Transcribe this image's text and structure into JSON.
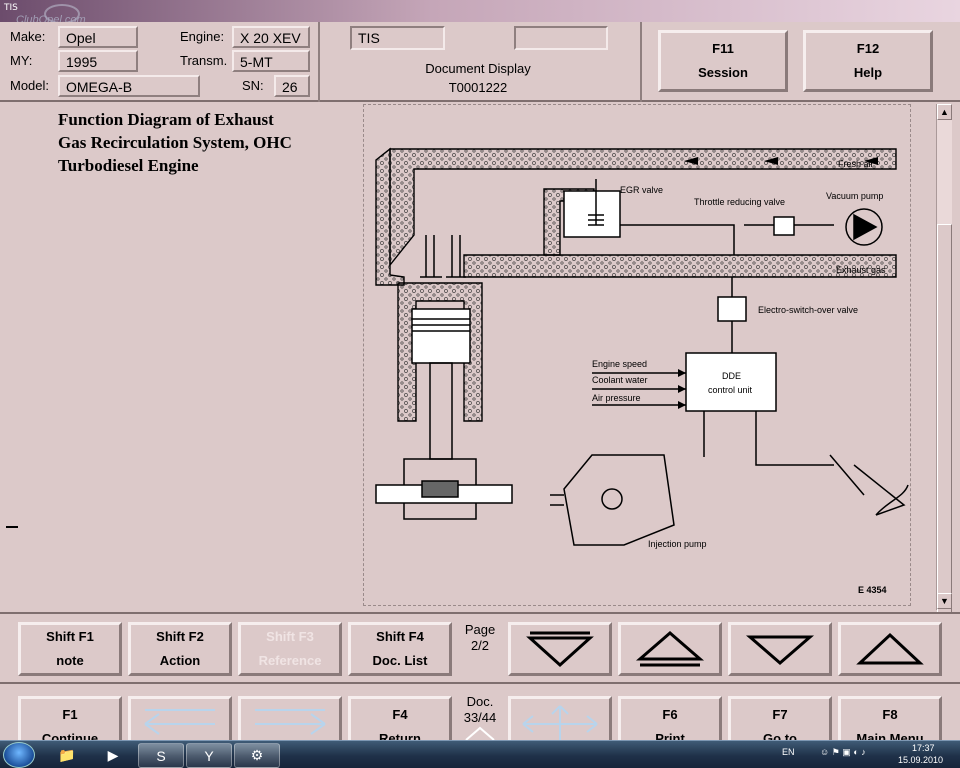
{
  "window": {
    "title": "TIS"
  },
  "watermark": "ClubOpel.com",
  "vehicle": {
    "make_label": "Make:",
    "make": "Opel",
    "my_label": "MY:",
    "my": "1995",
    "model_label": "Model:",
    "model": "OMEGA-B",
    "engine_label": "Engine:",
    "engine": "X 20 XEV",
    "transm_label": "Transm.",
    "transm": "5-MT",
    "sn_label": "SN:",
    "sn": "26"
  },
  "document": {
    "app_field": "TIS",
    "empty_field": "",
    "display_label": "Document Display",
    "id": "T0001222"
  },
  "top_buttons": [
    {
      "key": "F11",
      "label": "Session"
    },
    {
      "key": "F12",
      "label": "Help"
    }
  ],
  "content": {
    "title_lines": [
      "Function Diagram of Exhaust",
      "Gas Recirculation System, OHC",
      "Turbodiesel Engine"
    ],
    "diagram_labels": {
      "fresh_air": "Fresh air",
      "egr_valve": "EGR valve",
      "throttle_valve": "Throttle reducing valve",
      "vacuum_pump": "Vacuum pump",
      "exhaust_gas": "Exhaust gas",
      "switch_valve": "Electro-switch-over valve",
      "engine_speed": "Engine speed",
      "coolant_water": "Coolant water",
      "air_pressure": "Air pressure",
      "dde_line1": "DDE",
      "dde_line2": "control unit",
      "injection_pump": "Injection pump",
      "figure_ref": "E 4354"
    }
  },
  "nav_row": {
    "buttons": [
      {
        "key": "Shift F1",
        "label": "note",
        "enabled": true
      },
      {
        "key": "Shift F2",
        "label": "Action",
        "enabled": true
      },
      {
        "key": "Shift F3",
        "label": "Reference",
        "enabled": false
      },
      {
        "key": "Shift F4",
        "label": "Doc. List",
        "enabled": true
      }
    ],
    "page_label": "Page",
    "page_value": "2/2"
  },
  "func_row": {
    "f1": {
      "key": "F1",
      "label": "Continue"
    },
    "f4": {
      "key": "F4",
      "label": "Return"
    },
    "doc_label": "Doc.",
    "doc_value": "33/44",
    "f6": {
      "key": "F6",
      "label": "Print"
    },
    "f7": {
      "key": "F7",
      "label": "Go to"
    },
    "f8": {
      "key": "F8",
      "label": "Main Menu"
    }
  },
  "taskbar": {
    "lang": "EN",
    "time": "17:37",
    "date": "15.09.2010"
  },
  "colors": {
    "panel": "#dcc9c9",
    "shadow": "#8a7a7a",
    "highlight": "#f6eeee",
    "taskbar": "#1f3149"
  }
}
